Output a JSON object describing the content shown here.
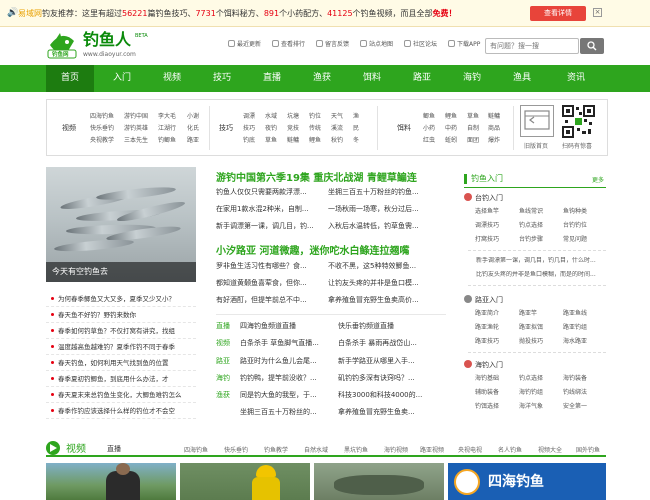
{
  "notice": {
    "brand": "易域网",
    "text_a": "钓友推荐：这里有超过",
    "num1": "56221",
    "text_b": "篇钓鱼技巧、",
    "num2": "7731",
    "text_c": "个饵料秘方、",
    "num3": "891",
    "text_d": "个小药配方、",
    "num4": "41125",
    "text_e": "个钓鱼视频，而且全部",
    "free": "免费！",
    "button": "查看详情",
    "close": "×"
  },
  "header": {
    "logo_title": "钓鱼人",
    "logo_beta": "BETA",
    "logo_url": "www.diaoyur.com",
    "logo_badge": "钓鱼网",
    "quick_links": [
      "最近更新",
      "查看排行",
      "留言反馈",
      "站点地图",
      "社区论坛",
      "下载APP"
    ],
    "search_placeholder": "有问题？搜一搜"
  },
  "nav": [
    "首页",
    "入门",
    "视频",
    "技巧",
    "直播",
    "渔获",
    "饵料",
    "路亚",
    "海钓",
    "渔具",
    "资讯"
  ],
  "subnav": {
    "video_label": "视频",
    "video_cols": [
      [
        "四海钓鱼",
        "快乐垂钓",
        "央视教学"
      ],
      [
        "游钓中国",
        "游钓英雄",
        "三本先生"
      ],
      [
        "李大毛",
        "江湖行",
        "钓鲫鱼"
      ],
      [
        "小谢",
        "化氏",
        "路亚"
      ]
    ],
    "skill_label": "技巧",
    "skill_cols": [
      [
        "调漂",
        "技巧",
        "钓底"
      ],
      [
        "水域",
        "夜钓",
        "草鱼"
      ],
      [
        "坑塘",
        "竞技",
        "鲢鳙"
      ],
      [
        "钓位",
        "传统",
        "鲤鱼"
      ],
      [
        "天气",
        "溪流",
        "秋钓"
      ],
      [
        "渔",
        "民",
        "冬"
      ]
    ],
    "bait_label": "饵料",
    "bait_cols": [
      [
        "鲫鱼",
        "小药",
        "红虫"
      ],
      [
        "鲤鱼",
        "中药",
        "蚯蚓"
      ],
      [
        "草鱼",
        "自制",
        "面团"
      ],
      [
        "鲢鳙",
        "商品",
        "爆炸"
      ]
    ],
    "old_home": "旧版首页",
    "qr_caption": "扫码有惊喜"
  },
  "left": {
    "photo_caption": "今天有空钓鱼去",
    "list": [
      "为何春季鲫鱼又大又多，夏季又少又小？",
      "春天鱼不好钓？野钓来数你",
      "春季如何钓草鱼？不仅打窝有讲究，找组",
      "温度越高鱼越难钓？夏季作钓不同于春季",
      "春天钓鱼，如何利用天气找到鱼的位置",
      "春季夏初钓鲫鱼，到底用什么办法，才",
      "春天夏末来总钓鱼生变化，大鲫鱼难钓怎么",
      "春季作钓应该选择什么样的钓位才不会空"
    ]
  },
  "middle": {
    "headline1": "游钓中国第六季19集 重庆北战湖 青鲤草鳊连",
    "b1_left": [
      "钓鱼人仅仅只需要两款浮漂...",
      "在家用1款水混2种米，自制...",
      "新手调漂第一课，调几目，钓..."
    ],
    "b1_right": [
      "坐拥三百五十万粉丝的钓鱼...",
      "一场秋雨一场寒，秋分过后...",
      "入秋后水温转低，钓草鱼需..."
    ],
    "headline2": "小汐路亚 河道微趣，迷你咜水白鲦连拉翘嘴",
    "b2_left": [
      "罗非鱼生活习性有哪些？食...",
      "都知道黄颡鱼喜荤食，但你...",
      "有好酒酊，但提竿前总不中..."
    ],
    "b2_right": [
      "不收不黑，这5种特效鲫鱼...",
      "让钓友头疼的并非是鱼口模...",
      "拿养殖鱼冒充野生鱼卖高价..."
    ],
    "cat_rows": [
      {
        "cat": "直播",
        "left": "四海钓鱼频道直播",
        "right": "快乐垂钓频道直播"
      },
      {
        "cat": "视频",
        "left": "白条杀手 草鱼脚气直播...",
        "right": "白条杀手 暴雨再战岱山..."
      },
      {
        "cat": "路亚",
        "left": "路亚时为什么鱼儿会尾...",
        "right": "新手学路亚从哪里入手..."
      },
      {
        "cat": "海钓",
        "left": "钓钓鸭，提竿前没收？...",
        "right": "矶钓钓多深有诀窍吗？..."
      },
      {
        "cat": "渔获",
        "left": "同是钓大鱼的我型，于...",
        "right": "科技3000和科技4000的..."
      },
      {
        "cat": "",
        "left": "坐拥三百五十万粉丝的...",
        "right": "拿养殖鱼冒充野生鱼卖..."
      }
    ]
  },
  "right": {
    "title": "钓鱼入门",
    "more": "更多",
    "sec1": {
      "title": "台钓入门",
      "cells": [
        "选择鱼竿",
        "鱼线常识",
        "鱼钩种类",
        "调漂技巧",
        "钓点选择",
        "台钓钓位",
        "打窝技巧",
        "台钓步骤",
        "常见问题"
      ]
    },
    "sec1_text": [
      "新手调漂第一课，调几目，钓几目，什么时...",
      "比钓友头疼的并非是鱼口模糊，而是的时间..."
    ],
    "sec2": {
      "title": "路亚入门",
      "cells": [
        "路亚简介",
        "路亚竿",
        "路亚鱼线",
        "路亚渔轮",
        "路亚拟饵",
        "路亚钓组",
        "路亚技巧",
        "抛投技巧",
        "海水路亚"
      ]
    },
    "sec3": {
      "title": "海钓入门",
      "cells": [
        "海钓基础",
        "钓点选择",
        "海钓装备",
        "辅助装备",
        "海钓钓组",
        "钓线绑法",
        "钓饵选择",
        "海洋气象",
        "安全第一"
      ]
    }
  },
  "bottom": {
    "title": "视频",
    "tabs": [
      "直播",
      "四海钓鱼",
      "快乐垂钓",
      "钓鱼教学",
      "自然水域",
      "黑坑钓鱼",
      "海钓视频",
      "路亚视频",
      "央视电视",
      "名人钓鱼",
      "视频大全",
      "国外钓鱼"
    ],
    "banner_text": "四海钓鱼"
  },
  "colors": {
    "accent": "#2ea51e",
    "accent_dark": "#1d7c10",
    "red": "#e60012",
    "button": "#e8443a"
  }
}
